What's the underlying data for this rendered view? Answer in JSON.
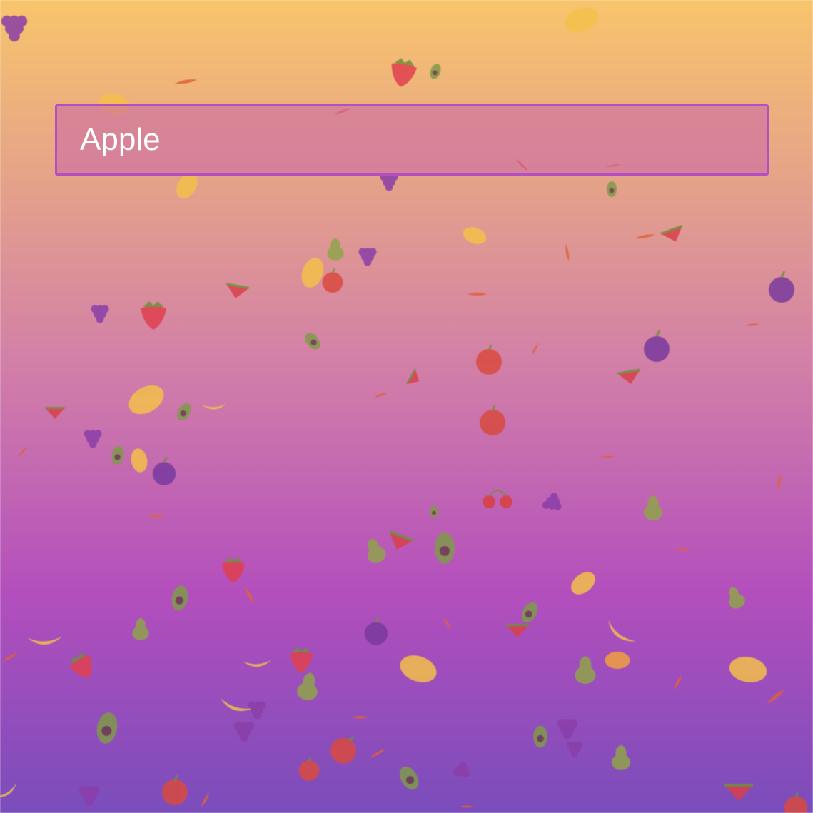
{
  "background": {
    "gradient_top": "#f8c56c",
    "gradient_mid": "#b34fbd",
    "gradient_bottom": "#7a4dbb"
  },
  "search": {
    "value": "Apple",
    "placeholder": "",
    "border_color": "#b34fc0"
  },
  "fruit_colors": {
    "strawberry": "#e0404f",
    "lemon": "#f3c04a",
    "orange": "#f0a040",
    "grape": "#8a3ea8",
    "plum": "#7a3a9e",
    "avocado": "#7f9a4a",
    "pear": "#8fa34a",
    "watermelon": "#d9404a",
    "carrot": "#e0603a",
    "cherry": "#d94040",
    "apple": "#d94a3f",
    "banana": "#f0c24a"
  }
}
